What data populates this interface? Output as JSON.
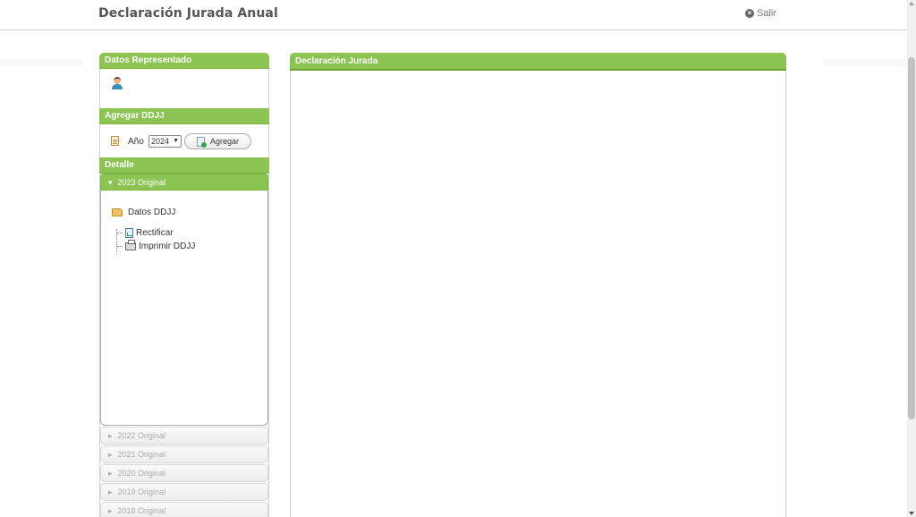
{
  "header": {
    "title": "Declaración Jurada Anual",
    "logout_label": "Salir"
  },
  "left": {
    "represented_title": "Datos Representado",
    "add_title": "Agregar DDJJ",
    "year_label": "Año",
    "year_selected": "2024",
    "add_button_label": "Agregar",
    "detail_title": "Detalle",
    "accordion_active": "2023 Original",
    "tree": {
      "root": "Datos DDJJ",
      "items": [
        "Rectificar",
        "Imprimir DDJJ"
      ]
    },
    "accordion_collapsed": [
      "2022 Original",
      "2021 Original",
      "2020 Original",
      "2019 Original",
      "2018 Original"
    ]
  },
  "right": {
    "title": "Declaración Jurada"
  },
  "colors": {
    "accent": "#8cc453"
  }
}
